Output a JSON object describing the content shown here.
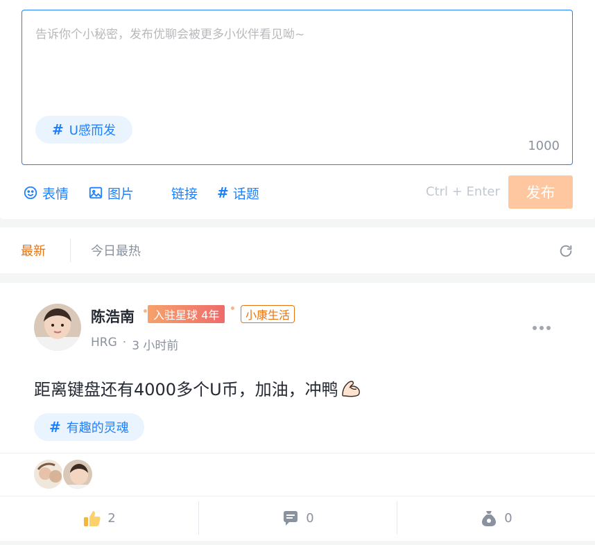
{
  "composer": {
    "placeholder": "告诉你个小秘密，发布优聊会被更多小伙伴看见呦~",
    "topic": "U感而发",
    "char_limit": "1000",
    "toolbar": {
      "emoji": "表情",
      "image": "图片",
      "link": "链接",
      "topic": "话题"
    },
    "shortcut": "Ctrl + Enter",
    "publish": "发布"
  },
  "tabs": {
    "latest": "最新",
    "hot": "今日最热"
  },
  "post": {
    "author": "陈浩南",
    "badge_years": "入驻星球 4年",
    "badge_tag": "小康生活",
    "company": "HRG",
    "dot": "·",
    "time": "3 小时前",
    "content": "距离键盘还有4000多个U币，加油，冲鸭",
    "topic": "有趣的灵魂",
    "likes": "2",
    "comments": "0",
    "coins": "0"
  },
  "colors": {
    "accent_blue": "#1e80ff",
    "accent_orange": "#e8730e",
    "publish_bg": "#fec7a0"
  }
}
